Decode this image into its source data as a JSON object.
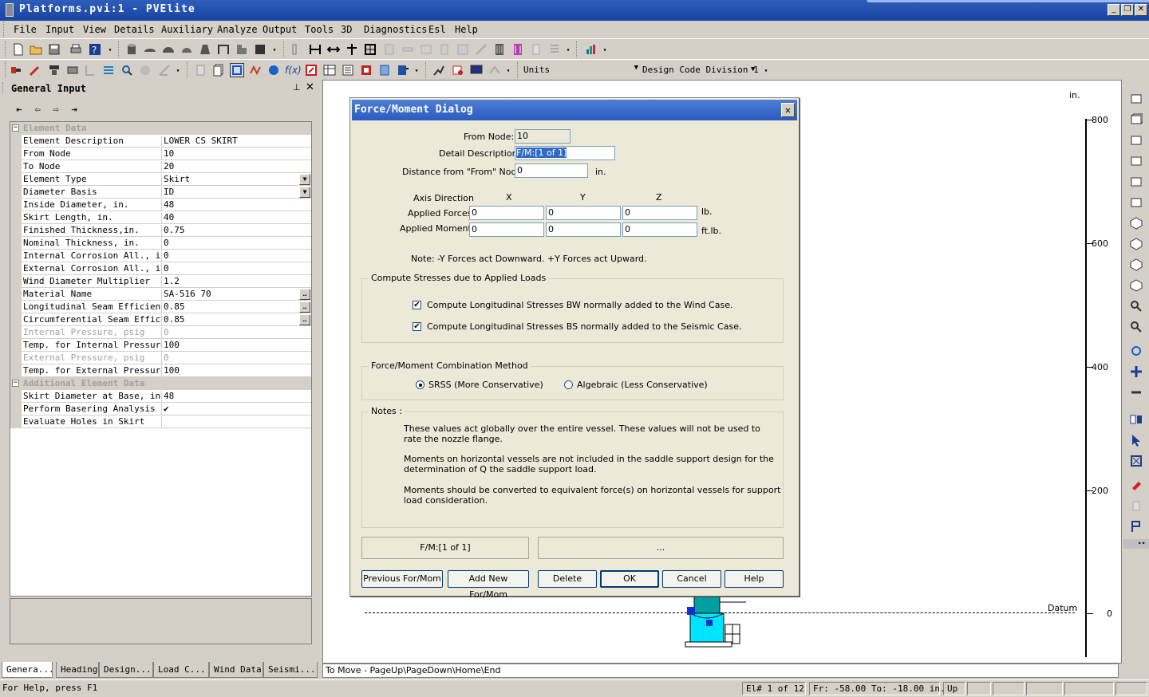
{
  "window": {
    "title": "Platforms.pvi:1 - PVElite"
  },
  "menu": [
    "File",
    "Input",
    "View",
    "Details",
    "Auxiliary",
    "Analyze",
    "Output",
    "Tools",
    "3D",
    "Diagnostics",
    "Esl",
    "Help"
  ],
  "toolbar": {
    "units_label": "Units",
    "code_selector": "Design Code Division 1"
  },
  "left_panel": {
    "title": "General Input",
    "rows": [
      {
        "label": "Element Data",
        "value": "",
        "section": true
      },
      {
        "label": "Element Description",
        "value": "LOWER CS SKIRT"
      },
      {
        "label": "From Node",
        "value": "10"
      },
      {
        "label": "To Node",
        "value": "20"
      },
      {
        "label": "Element Type",
        "value": "Skirt",
        "dropdown": true
      },
      {
        "label": "Diameter Basis",
        "value": "ID",
        "dropdown": true
      },
      {
        "label": "Inside Diameter, in.",
        "value": "48"
      },
      {
        "label": "Skirt Length, in.",
        "value": "40"
      },
      {
        "label": "Finished Thickness,in.",
        "value": "0.75"
      },
      {
        "label": "Nominal Thickness, in.",
        "value": "0"
      },
      {
        "label": "Internal Corrosion All., in.",
        "value": "0"
      },
      {
        "label": "External Corrosion All., in.",
        "value": "0"
      },
      {
        "label": "Wind Diameter Multiplier",
        "value": "1.2"
      },
      {
        "label": "Material Name",
        "value": "SA-516 70",
        "ellipsis": true
      },
      {
        "label": "Longitudinal Seam Efficiency",
        "value": "0.85",
        "ellipsis": true
      },
      {
        "label": "Circumferential Seam Efficiency",
        "value": "0.85",
        "ellipsis": true
      },
      {
        "label": "Internal Pressure, psig",
        "value": "0",
        "grey": true
      },
      {
        "label": "Temp. for Internal Pressure,",
        "value": "100"
      },
      {
        "label": "External Pressure, psig",
        "value": "0",
        "grey": true
      },
      {
        "label": "Temp. for External Pressure,",
        "value": "100"
      },
      {
        "label": "Additional Element Data",
        "value": "",
        "section": true
      },
      {
        "label": "Skirt Diameter at Base, in.",
        "value": "48"
      },
      {
        "label": "Perform Basering Analysis",
        "value": "✔"
      },
      {
        "label": "Evaluate Holes in Skirt",
        "value": ""
      }
    ],
    "tabs": [
      "Genera...",
      "Heading",
      "Design...",
      "Load C...",
      "Wind Data",
      "Seismi..."
    ]
  },
  "dialog": {
    "title": "Force/Moment Dialog",
    "from_node_label": "From Node:",
    "from_node": "10",
    "detail_label": "Detail Description:",
    "detail": "F/M:[1 of 1]",
    "distance_label": "Distance from \"From\" Node:",
    "distance": "0",
    "distance_unit": "in.",
    "axis_label": "Axis Direction",
    "axes": [
      "X",
      "Y",
      "Z"
    ],
    "forces_label": "Applied Forces",
    "forces": [
      "0",
      "0",
      "0"
    ],
    "forces_unit": "lb.",
    "moments_label": "Applied Moments",
    "moments": [
      "0",
      "0",
      "0"
    ],
    "moments_unit": "ft.lb.",
    "note": "Note: -Y Forces act Downward.  +Y Forces act Upward.",
    "stress_group": "Compute Stresses due to Applied Loads",
    "chk_wind": "Compute Longitudinal Stresses BW normally added to the Wind Case.",
    "chk_seismic": "Compute Longitudinal Stresses BS normally added to the Seismic Case.",
    "method_group": "Force/Moment Combination Method",
    "radio_srss": "SRSS (More Conservative)",
    "radio_alg": "Algebraic (Less Conservative)",
    "notes_group": "Notes :",
    "notes": [
      [
        "These values act globally over the entire vessel.  These values will not be used to",
        "rate the nozzle flange."
      ],
      [
        "Moments on horizontal vessels are not included in the saddle support design for the",
        "determination of Q the saddle support load."
      ],
      [
        "Moments should be converted to equivalent force(s) on horizontal vessels for support",
        "load consideration."
      ]
    ],
    "pane_left": "F/M:[1 of 1]",
    "pane_right": "...",
    "btn_prev": "Previous For/Mom",
    "btn_add": "Add New For/Mom",
    "btn_delete": "Delete",
    "btn_ok": "OK",
    "btn_cancel": "Cancel",
    "btn_help": "Help"
  },
  "canvas": {
    "unit": "in.",
    "ticks": [
      "800",
      "600",
      "400",
      "200",
      "0"
    ],
    "datum": "Datum",
    "status": "To Move - PageUp\\PageDown\\Home\\End"
  },
  "statusbar": {
    "help": "For Help, press F1",
    "element": "El# 1 of 12",
    "range": "Fr: -58.00 To: -18.00 in.",
    "direction": "Up"
  },
  "colors": {
    "title_bar": "#1a44a0",
    "vessel": "#00e5ff",
    "vessel_dark": "#00a0a0"
  }
}
